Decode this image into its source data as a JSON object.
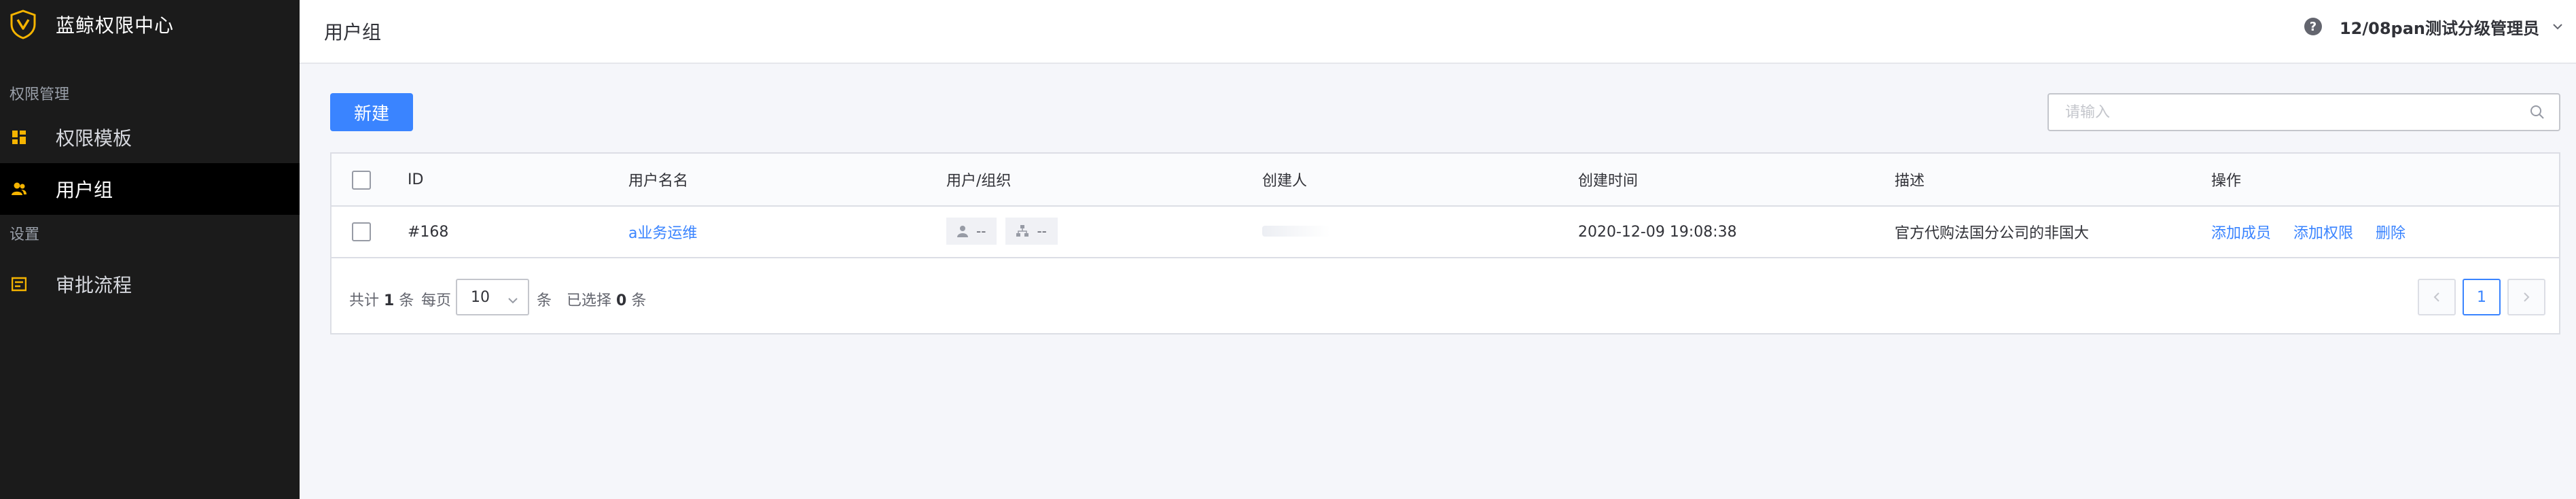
{
  "app": {
    "brand_title": "蓝鲸权限中心",
    "brand_color": "#f5b400"
  },
  "sidebar": {
    "groups": [
      {
        "label": "权限管理"
      },
      {
        "label": "设置"
      }
    ],
    "items": [
      {
        "label": "权限模板",
        "icon": "template-grid-icon",
        "active": false
      },
      {
        "label": "用户组",
        "icon": "user-group-icon",
        "active": true
      },
      {
        "label": "审批流程",
        "icon": "approval-flow-icon",
        "active": false
      }
    ]
  },
  "header": {
    "title": "用户组",
    "help_icon": "?",
    "user_label": "12/08pan测试分级管理员"
  },
  "toolbar": {
    "new_button": "新建",
    "search_placeholder": "请输入"
  },
  "table": {
    "columns": [
      "ID",
      "用户名名",
      "用户/组织",
      "创建人",
      "创建时间",
      "描述",
      "操作"
    ],
    "rows": [
      {
        "id": "#168",
        "name": "a业务运维",
        "users": "--",
        "orgs": "--",
        "creator": "",
        "created_at": "2020-12-09 19:08:38",
        "description": "官方代购法国分公司的非国大",
        "actions": [
          "添加成员",
          "添加权限",
          "删除"
        ]
      }
    ]
  },
  "pagination": {
    "total_prefix": "共计",
    "total": "1",
    "total_suffix": "条",
    "per_page_label": "每页",
    "page_size": "10",
    "per_page_unit": "条",
    "selected_prefix": "已选择",
    "selected": "0",
    "selected_suffix": "条",
    "current_page": "1"
  },
  "colors": {
    "primary": "#3a84ff",
    "sidebar_bg": "#1b1b1b"
  }
}
